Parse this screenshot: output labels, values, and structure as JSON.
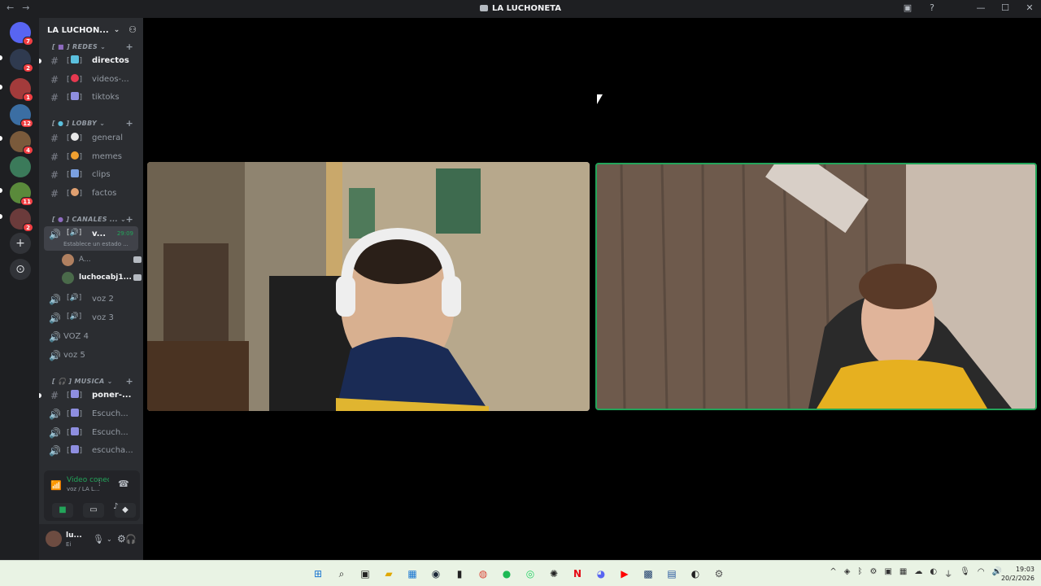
{
  "window": {
    "title": "LA LUCHONETA",
    "nav_back": "←",
    "nav_forward": "→",
    "inbox_icon": "inbox-icon",
    "help_icon": "?",
    "minimize": "—",
    "maximize": "☐",
    "close": "✕"
  },
  "servers": {
    "home_badge": "7",
    "items": [
      {
        "badge": "2",
        "color": "#2f3a4f"
      },
      {
        "badge": "1",
        "color": "#a33b3b"
      },
      {
        "badge": "12",
        "color": "#3b6ea3"
      },
      {
        "badge": "4",
        "color": "#7a5a3b"
      },
      {
        "badge": "",
        "color": "#3b7a5a"
      },
      {
        "badge": "11",
        "color": "#5a8a3b"
      },
      {
        "badge": "2",
        "color": "#6b3b3b"
      }
    ],
    "add_label": "+",
    "discover_label": "⊙"
  },
  "guild": {
    "name": "LA LUCHON...",
    "chevron": "⌄",
    "invite_icon": "👤+"
  },
  "categories": {
    "redes": "REDES",
    "lobby": "LOBBY",
    "canales": "CANALES ...",
    "musica": "MUSICA"
  },
  "channels": {
    "directos": "directos",
    "videos": "videos-...",
    "tiktoks": "tiktoks",
    "general": "general",
    "memes": "memes",
    "clips": "clips",
    "factos": "factos",
    "v": "v...",
    "v_time": "29:09",
    "v_status": "Establece un estado ...",
    "voz2": "voz 2",
    "voz3": "voz 3",
    "voz4": "VOZ 4",
    "voz5": "voz 5",
    "poner": "poner-...",
    "escuch1": "Escuch...",
    "escuch2": "Escuch...",
    "escucha3": "escucha..."
  },
  "voice_users": {
    "user1": "A...",
    "user2": "luchocabj1..."
  },
  "voice_panel": {
    "title": "Video conectad",
    "subtitle": "voz / LA L..."
  },
  "user": {
    "name": "lu...",
    "status": "Ei"
  },
  "clock": {
    "time": "19:03",
    "date": "20/2/2026"
  },
  "colors": {
    "accent_green": "#23a55a",
    "badge_red": "#f23f43",
    "sidebar": "#2b2d31",
    "rail": "#1e1f22"
  }
}
